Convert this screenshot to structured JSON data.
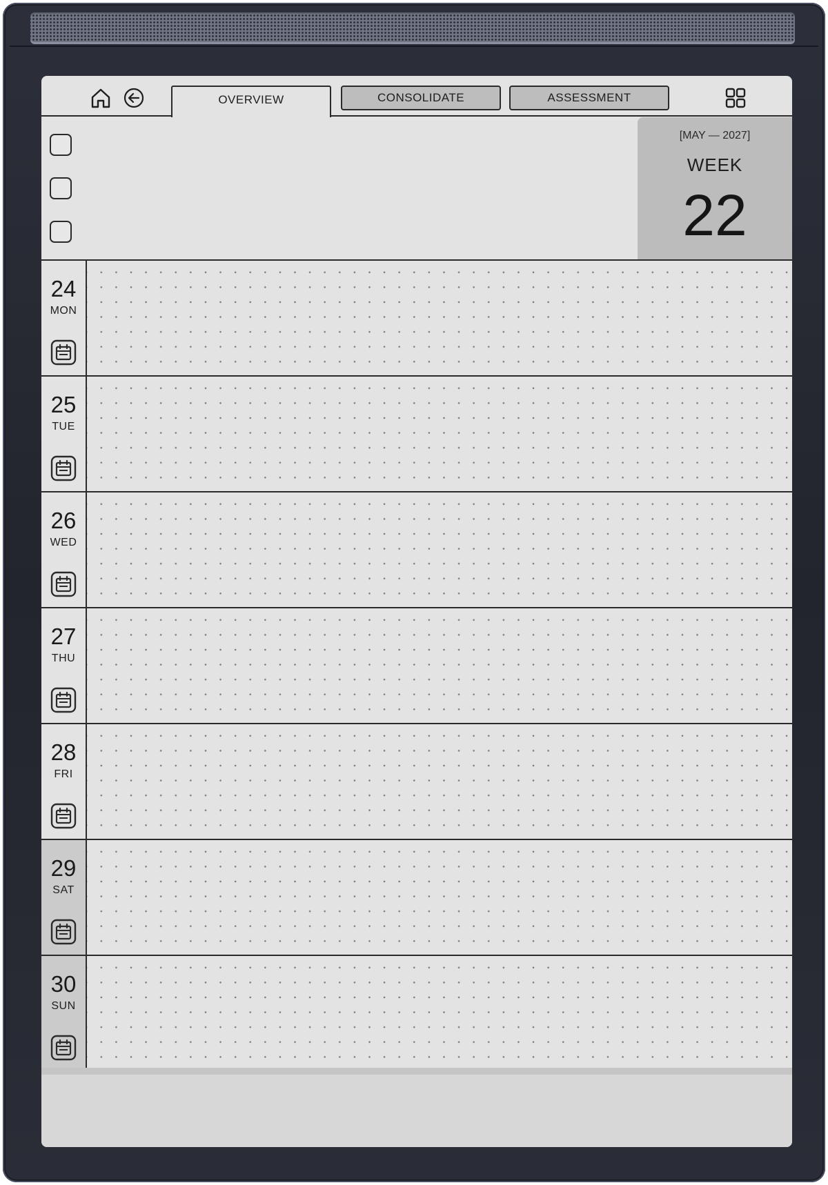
{
  "nav": {
    "home_icon": "home-icon",
    "back_icon": "arrow-left-circle-icon",
    "grid_icon": "grid-icon",
    "tabs": [
      {
        "label": "OVERVIEW",
        "active": true
      },
      {
        "label": "CONSOLIDATE",
        "active": false
      },
      {
        "label": "ASSESSMENT",
        "active": false
      }
    ]
  },
  "header": {
    "checkbox_count": 3,
    "week_range": "[MAY — 2027]",
    "week_label": "WEEK",
    "week_number": "22"
  },
  "days": [
    {
      "num": "24",
      "name": "MON",
      "weekend": false
    },
    {
      "num": "25",
      "name": "TUE",
      "weekend": false
    },
    {
      "num": "26",
      "name": "WED",
      "weekend": false
    },
    {
      "num": "27",
      "name": "THU",
      "weekend": false
    },
    {
      "num": "28",
      "name": "FRI",
      "weekend": false
    },
    {
      "num": "29",
      "name": "SAT",
      "weekend": true
    },
    {
      "num": "30",
      "name": "SUN",
      "weekend": true
    }
  ],
  "colors": {
    "screen": "#e2e3e2",
    "ink": "#2a2a2a",
    "inactive_tab": "#bcbdbc",
    "week_card": "#bcbcbc",
    "weekend_label": "#cacbca"
  }
}
